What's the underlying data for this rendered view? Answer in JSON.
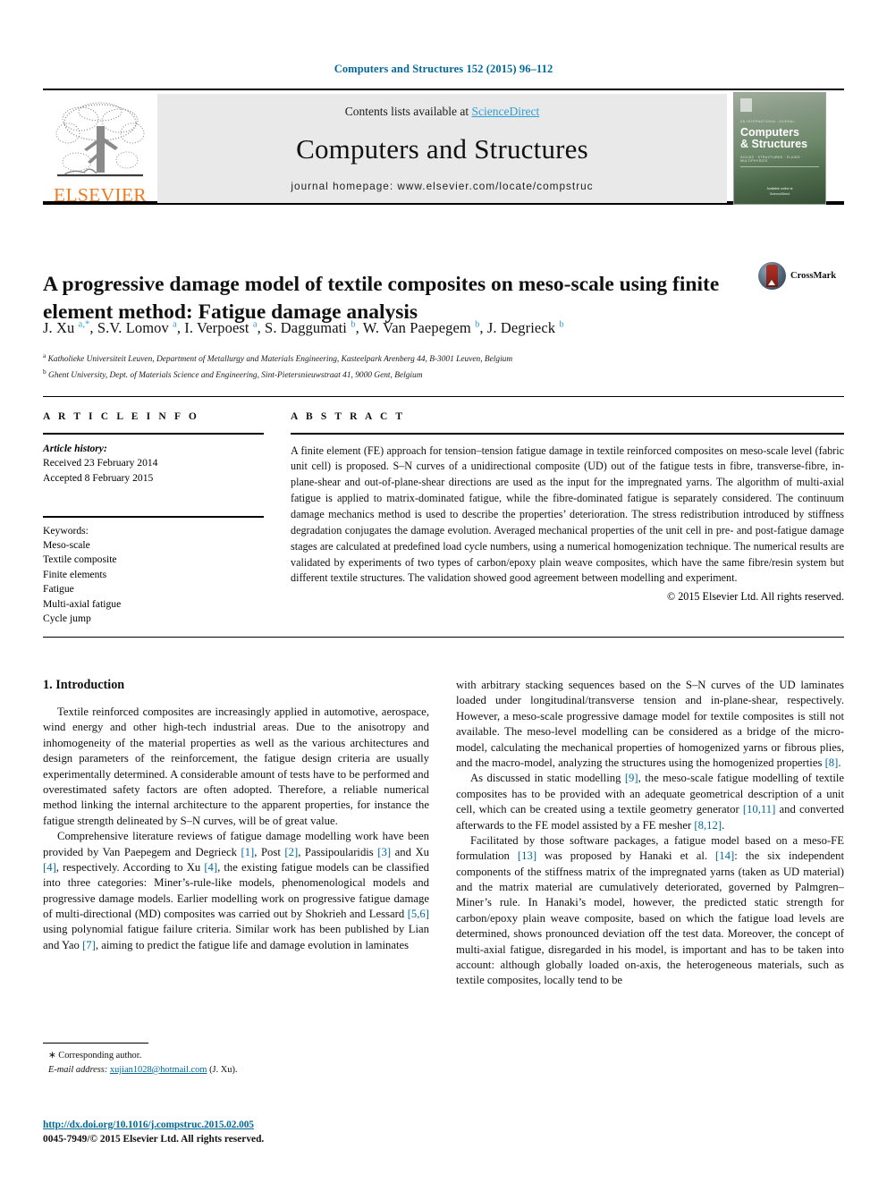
{
  "running_head": "Computers and Structures 152 (2015) 96–112",
  "masthead": {
    "contents_prefix": "Contents lists available at ",
    "sciencedirect": "ScienceDirect",
    "journal_name": "Computers and Structures",
    "homepage": "journal homepage: www.elsevier.com/locate/compstruc",
    "publisher_logo_text": "ELSEVIER",
    "cover": {
      "title_line1": "Computers",
      "title_line2": "& Structures",
      "kicker": "AN INTERNATIONAL JOURNAL",
      "subtitle": "SOLIDS · STRUCTURES · FLUIDS · MULTIPHYSICS",
      "footer_line1": "Available online at",
      "footer_line2": "ScienceDirect"
    }
  },
  "article": {
    "title": "A progressive damage model of textile composites on meso-scale using finite element method: Fatigue damage analysis",
    "crossmark_label": "CrossMark",
    "authors_html": "J. Xu <sup>a,*</sup>, S.V. Lomov <sup>a</sup>, I. Verpoest <sup>a</sup>, S. Daggumati <sup>b</sup>, W. Van Paepegem <sup>b</sup>, J. Degrieck <sup>b</sup>",
    "affiliations": [
      "Katholieke Universiteit Leuven, Department of Metallurgy and Materials Engineering, Kasteelpark Arenberg 44, B-3001 Leuven, Belgium",
      "Ghent University, Dept. of Materials Science and Engineering, Sint-Pietersnieuwstraat 41, 9000 Gent, Belgium"
    ],
    "affiliation_marks": [
      "a",
      "b"
    ]
  },
  "article_info": {
    "heading": "A R T I C L E   I N F O",
    "history_label": "Article history:",
    "history": [
      "Received 23 February 2014",
      "Accepted 8 February 2015"
    ],
    "keywords_label": "Keywords:",
    "keywords": [
      "Meso-scale",
      "Textile composite",
      "Finite elements",
      "Fatigue",
      "Multi-axial fatigue",
      "Cycle jump"
    ]
  },
  "abstract": {
    "heading": "A B S T R A C T",
    "text": "A finite element (FE) approach for tension–tension fatigue damage in textile reinforced composites on meso-scale level (fabric unit cell) is proposed. S–N curves of a unidirectional composite (UD) out of the fatigue tests in fibre, transverse-fibre, in-plane-shear and out-of-plane-shear directions are used as the input for the impregnated yarns. The algorithm of multi-axial fatigue is applied to matrix-dominated fatigue, while the fibre-dominated fatigue is separately considered. The continuum damage mechanics method is used to describe the properties’ deterioration. The stress redistribution introduced by stiffness degradation conjugates the damage evolution. Averaged mechanical properties of the unit cell in pre- and post-fatigue damage stages are calculated at predefined load cycle numbers, using a numerical homogenization technique. The numerical results are validated by experiments of two types of carbon/epoxy plain weave composites, which have the same fibre/resin system but different textile structures. The validation showed good agreement between modelling and experiment.",
    "copyright": "© 2015 Elsevier Ltd. All rights reserved."
  },
  "body": {
    "section_heading": "1. Introduction",
    "left_paragraphs": [
      "Textile reinforced composites are increasingly applied in automotive, aerospace, wind energy and other high-tech industrial areas. Due to the anisotropy and inhomogeneity of the material properties as well as the various architectures and design parameters of the reinforcement, the fatigue design criteria are usually experimentally determined. A considerable amount of tests have to be performed and overestimated safety factors are often adopted. Therefore, a reliable numerical method linking the internal architecture to the apparent properties, for instance the fatigue strength delineated by S–N curves, will be of great value."
    ],
    "left_paragraph_2_parts": [
      {
        "t": "Comprehensive literature reviews of fatigue damage modelling work have been provided by Van Paepegem and Degrieck "
      },
      {
        "t": "[1]",
        "ref": true
      },
      {
        "t": ", Post "
      },
      {
        "t": "[2]",
        "ref": true
      },
      {
        "t": ", Passipoularidis "
      },
      {
        "t": "[3]",
        "ref": true
      },
      {
        "t": " and Xu "
      },
      {
        "t": "[4]",
        "ref": true
      },
      {
        "t": ", respectively. According to Xu "
      },
      {
        "t": "[4]",
        "ref": true
      },
      {
        "t": ", the existing fatigue models can be classified into three categories: Miner’s-rule-like models, phenomenological models and progressive damage models. Earlier modelling work on progressive fatigue damage of multi-directional (MD) composites was carried out by Shokrieh and Lessard "
      },
      {
        "t": "[5,6]",
        "ref": true
      },
      {
        "t": " using polynomial fatigue failure criteria. Similar work has been published by Lian and Yao "
      },
      {
        "t": "[7]",
        "ref": true
      },
      {
        "t": ", aiming to predict the fatigue life and damage evolution in laminates"
      }
    ],
    "right_paragraph_1_parts": [
      {
        "t": "with arbitrary stacking sequences based on the S–N curves of the UD laminates loaded under longitudinal/transverse tension and in-plane-shear, respectively. However, a meso-scale progressive damage model for textile composites is still not available. The meso-level modelling can be considered as a bridge of the micro-model, calculating the mechanical properties of homogenized yarns or fibrous plies, and the macro-model, analyzing the structures using the homogenized properties "
      },
      {
        "t": "[8]",
        "ref": true
      },
      {
        "t": "."
      }
    ],
    "right_paragraph_2_parts": [
      {
        "t": "As discussed in static modelling "
      },
      {
        "t": "[9]",
        "ref": true
      },
      {
        "t": ", the meso-scale fatigue modelling of textile composites has to be provided with an adequate geometrical description of a unit cell, which can be created using a textile geometry generator "
      },
      {
        "t": "[10,11]",
        "ref": true
      },
      {
        "t": " and converted afterwards to the FE model assisted by a FE mesher "
      },
      {
        "t": "[8,12]",
        "ref": true
      },
      {
        "t": "."
      }
    ],
    "right_paragraph_3_parts": [
      {
        "t": "Facilitated by those software packages, a fatigue model based on a meso-FE formulation "
      },
      {
        "t": "[13]",
        "ref": true
      },
      {
        "t": " was proposed by Hanaki et al. "
      },
      {
        "t": "[14]",
        "ref": true
      },
      {
        "t": ": the six independent components of the stiffness matrix of the impregnated yarns (taken as UD material) and the matrix material are cumulatively deteriorated, governed by Palmgren–Miner’s rule. In Hanaki’s model, however, the predicted static strength for carbon/epoxy plain weave composite, based on which the fatigue load levels are determined, shows pronounced deviation off the test data. Moreover, the concept of multi-axial fatigue, disregarded in his model, is important and has to be taken into account: although globally loaded on-axis, the heterogeneous materials, such as textile composites, locally tend to be"
      }
    ]
  },
  "footnote": {
    "corresponding": "∗ Corresponding author.",
    "email_label": "E-mail address:",
    "email": "xujian1028@hotmail.com",
    "email_owner": "(J. Xu)."
  },
  "footer": {
    "doi": "http://dx.doi.org/10.1016/j.compstruc.2015.02.005",
    "issn": "0045-7949/© 2015 Elsevier Ltd. All rights reserved."
  },
  "colors": {
    "link_blue": "#00699a",
    "sciencedirect_blue": "#2e9fd4",
    "elsevier_orange": "#eb7c22"
  }
}
